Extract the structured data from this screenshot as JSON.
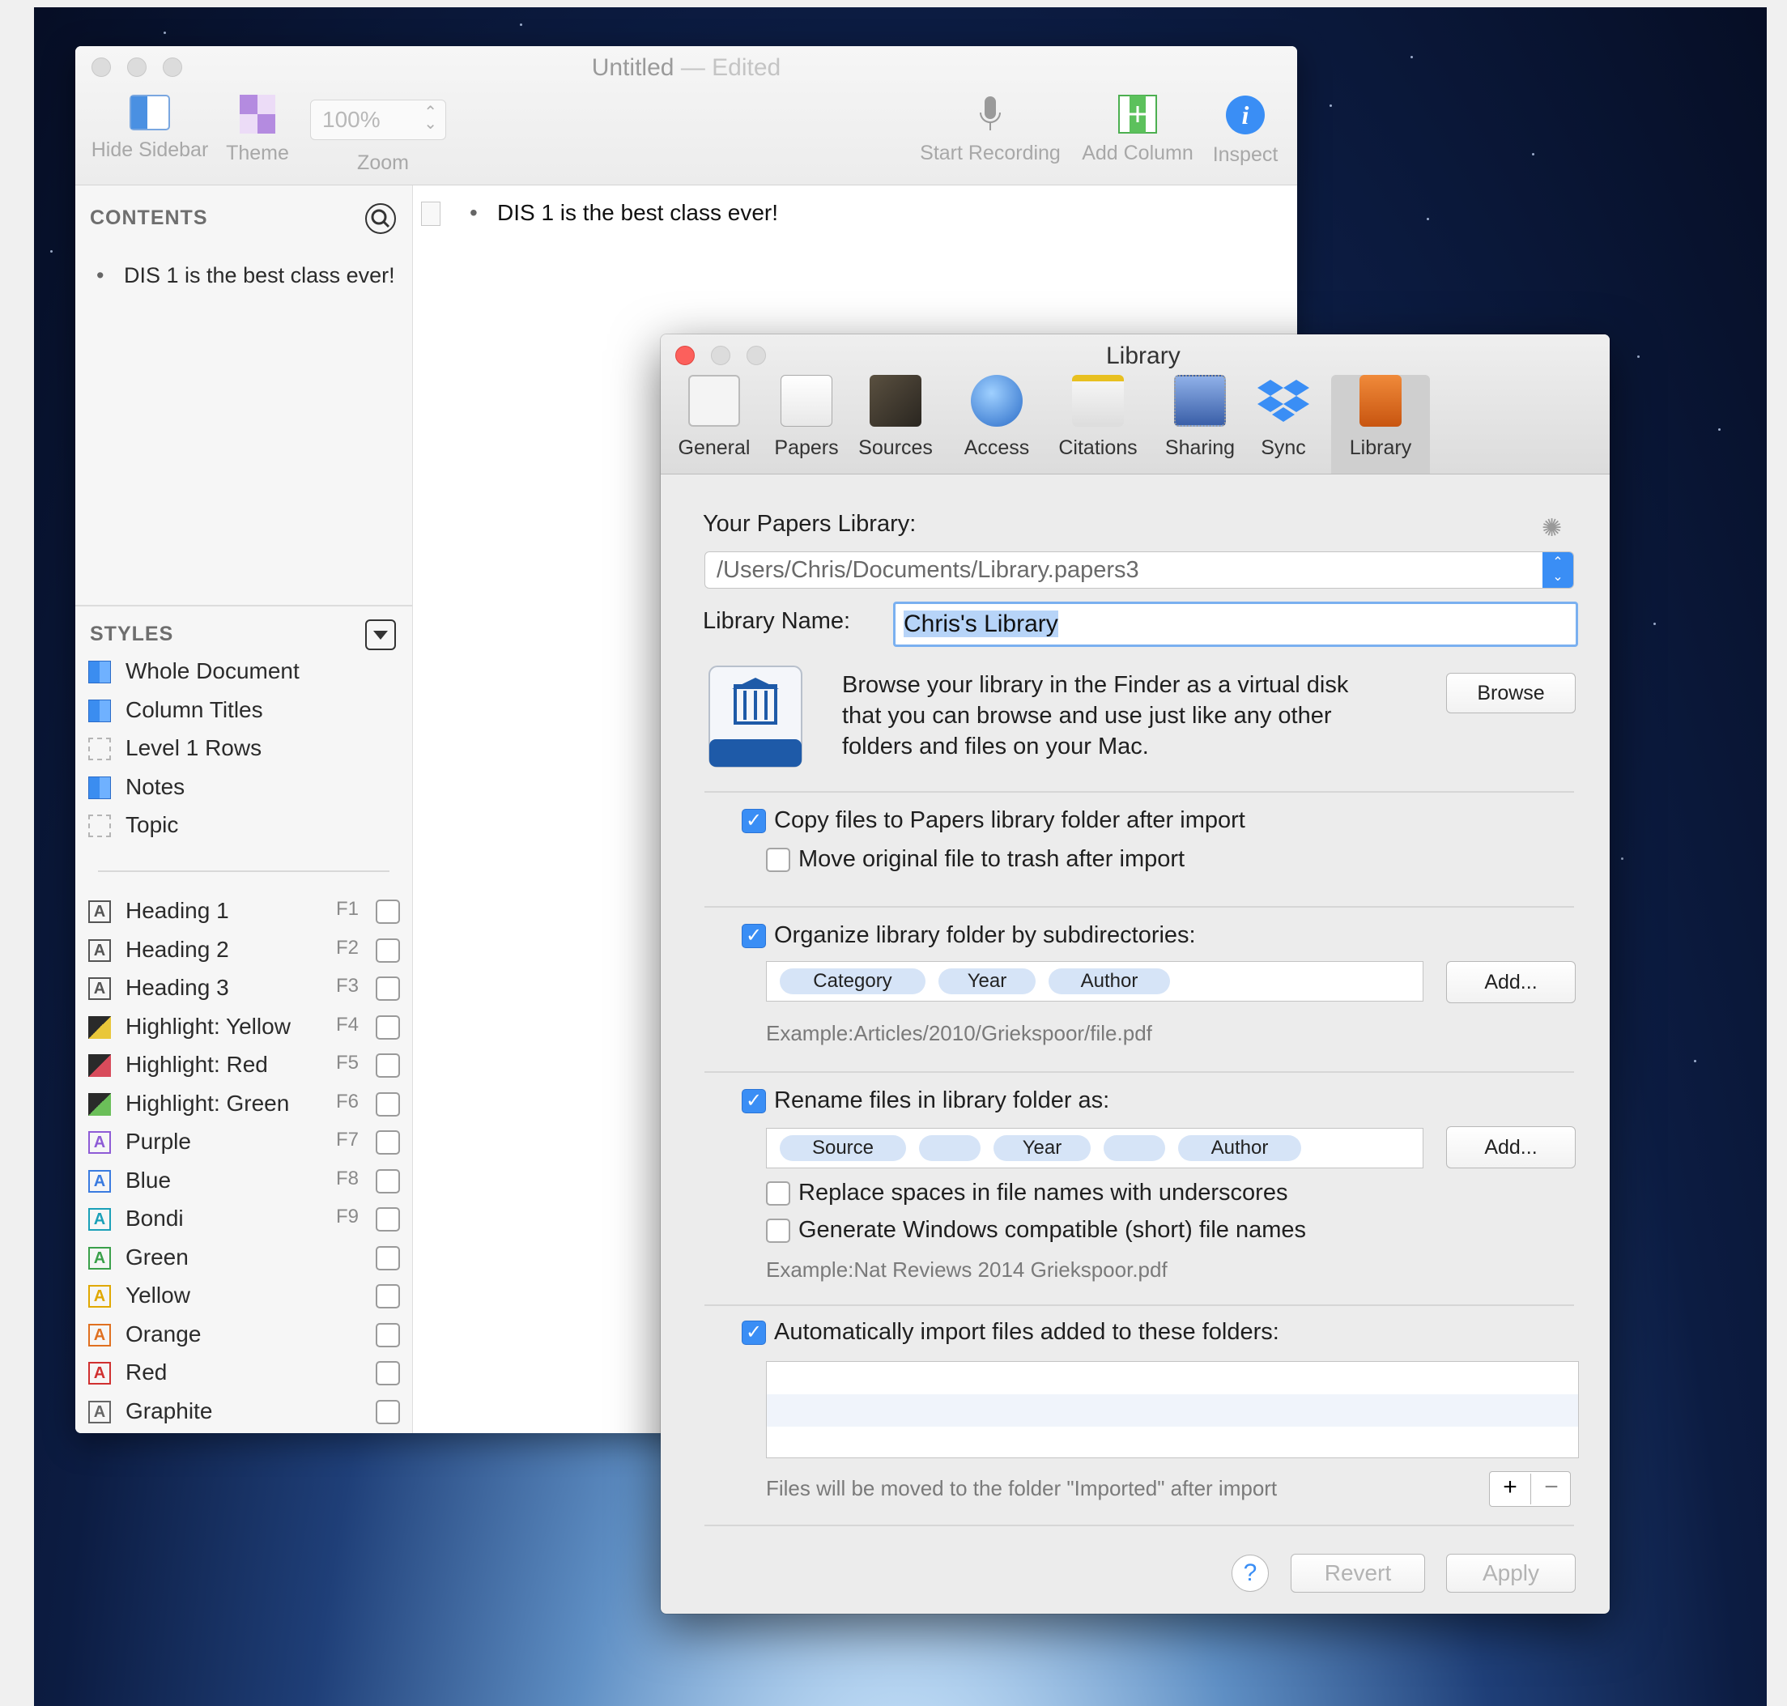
{
  "outliner": {
    "title": "Untitled",
    "title_sep": "—",
    "title_status": "Edited",
    "toolbar": {
      "hide_sidebar": "Hide Sidebar",
      "theme": "Theme",
      "zoom_value": "100%",
      "zoom": "Zoom",
      "start_recording": "Start Recording",
      "add_column": "Add Column",
      "inspect": "Inspect"
    },
    "contents_heading": "CONTENTS",
    "contents_items": [
      "DIS 1 is the best class ever!"
    ],
    "styles_heading": "STYLES",
    "styles": [
      {
        "label": "Whole Document",
        "swatch": "blue"
      },
      {
        "label": "Column Titles",
        "swatch": "blue"
      },
      {
        "label": "Level 1 Rows",
        "swatch": "dashed"
      },
      {
        "label": "Notes",
        "swatch": "blue"
      },
      {
        "label": "Topic",
        "swatch": "dashed"
      }
    ],
    "named_styles": [
      {
        "label": "Heading 1",
        "key": "F1",
        "icon": "A",
        "color": "#555555"
      },
      {
        "label": "Heading 2",
        "key": "F2",
        "icon": "A",
        "color": "#555555"
      },
      {
        "label": "Heading 3",
        "key": "F3",
        "icon": "A",
        "color": "#555555"
      },
      {
        "label": "Highlight: Yellow",
        "key": "F4",
        "icon": "",
        "color": "#e9c73a"
      },
      {
        "label": "Highlight: Red",
        "key": "F5",
        "icon": "",
        "color": "#d84b5b"
      },
      {
        "label": "Highlight: Green",
        "key": "F6",
        "icon": "",
        "color": "#6bbf59"
      },
      {
        "label": "Purple",
        "key": "F7",
        "icon": "A",
        "color": "#8e5bd6"
      },
      {
        "label": "Blue",
        "key": "F8",
        "icon": "A",
        "color": "#3a7be0"
      },
      {
        "label": "Bondi",
        "key": "F9",
        "icon": "A",
        "color": "#1aa0b8"
      },
      {
        "label": "Green",
        "key": "",
        "icon": "A",
        "color": "#3aa04a"
      },
      {
        "label": "Yellow",
        "key": "",
        "icon": "A",
        "color": "#e0a800"
      },
      {
        "label": "Orange",
        "key": "",
        "icon": "A",
        "color": "#e07020"
      },
      {
        "label": "Red",
        "key": "",
        "icon": "A",
        "color": "#d03030"
      },
      {
        "label": "Graphite",
        "key": "",
        "icon": "A",
        "color": "#666666"
      }
    ],
    "document_rows": [
      "DIS 1 is the best class ever!"
    ]
  },
  "prefs": {
    "title": "Library",
    "tabs": [
      "General",
      "Papers",
      "Sources",
      "Access",
      "Citations",
      "Sharing",
      "Sync",
      "Library"
    ],
    "active_tab": "Library",
    "library_label": "Your Papers Library:",
    "library_path": "/Users/Chris/Documents/Library.papers3",
    "name_label": "Library Name:",
    "name_value": "Chris's Library",
    "browse_text": [
      "Browse your library in the Finder as a virtual disk",
      "that you can browse and use just like any other",
      "folders and files on your Mac."
    ],
    "browse_button": "Browse",
    "copy_files": "Copy files to Papers library folder after import",
    "move_original": "Move original file to trash after import",
    "organize": "Organize library folder by subdirectories:",
    "organize_tokens": [
      "Category",
      "Year",
      "Author"
    ],
    "add_button": "Add...",
    "organize_example": "Example:Articles/2010/Griekspoor/file.pdf",
    "rename": "Rename files in library folder as:",
    "rename_tokens": [
      "Source",
      "",
      "Year",
      "",
      "Author"
    ],
    "replace_spaces": "Replace spaces in file names with underscores",
    "windows_names": "Generate Windows compatible (short) file names",
    "rename_example": "Example:Nat Reviews 2014 Griekspoor.pdf",
    "auto_import": "Automatically import files added to these folders:",
    "import_note": "Files will be moved to the folder \"Imported\" after import",
    "plus": "+",
    "minus": "−",
    "help": "?",
    "revert": "Revert",
    "apply": "Apply",
    "checked": {
      "copy_files": true,
      "move_original": false,
      "organize": true,
      "rename": true,
      "replace_spaces": false,
      "windows_names": false,
      "auto_import": true
    }
  },
  "colors": {
    "accent": "#3a8ef5",
    "close_red": "#fc605c"
  }
}
